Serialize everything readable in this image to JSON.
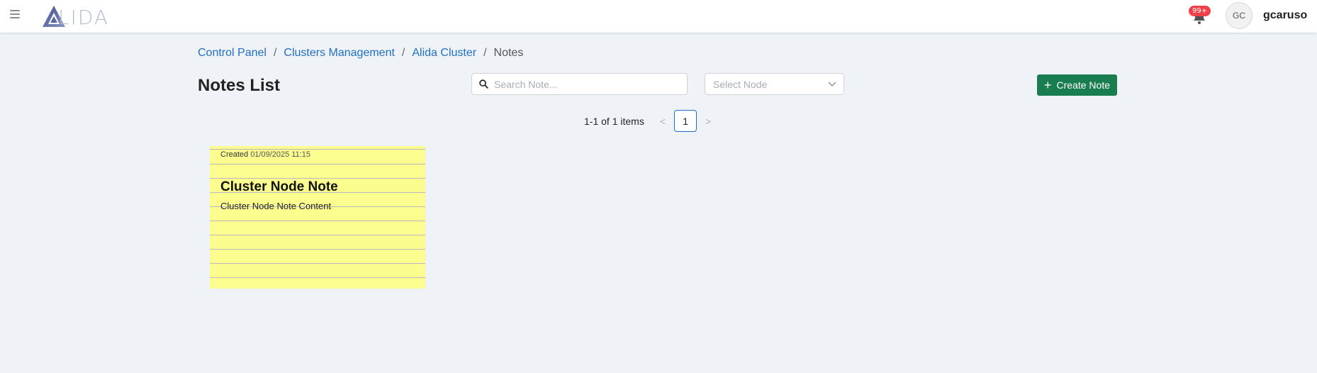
{
  "header": {
    "logo_text": "LIDA",
    "notification_badge": "99+",
    "avatar_initials": "GC",
    "username": "gcaruso"
  },
  "breadcrumb": {
    "items": [
      "Control Panel",
      "Clusters Management",
      "Alida Cluster"
    ],
    "current": "Notes",
    "separator": "/"
  },
  "main": {
    "title": "Notes List",
    "search_placeholder": "Search Note...",
    "select_placeholder": "Select Node",
    "create_label": "Create Note",
    "pagination": {
      "summary": "1-1 of 1 items",
      "current_page": "1",
      "prev_glyph": "<",
      "next_glyph": ">"
    },
    "notes": [
      {
        "created_label": "Created",
        "created_value": "01/09/2025 11:15",
        "title": "Cluster Node Note",
        "content": "Cluster Node Note Content"
      }
    ]
  },
  "colors": {
    "accent": "#1f6fc6",
    "create_button": "#1a7d4f",
    "note_background": "#fcfd8f",
    "badge": "#f0414b",
    "page_background": "#eff3f7"
  },
  "icons": {
    "menu": "hamburger-icon",
    "logo": "alida-logo-icon",
    "notifications": "bell-icon",
    "search": "search-icon",
    "dropdown": "chevron-down-icon",
    "create": "plus-icon",
    "prev": "chevron-left-icon",
    "next": "chevron-right-icon"
  }
}
